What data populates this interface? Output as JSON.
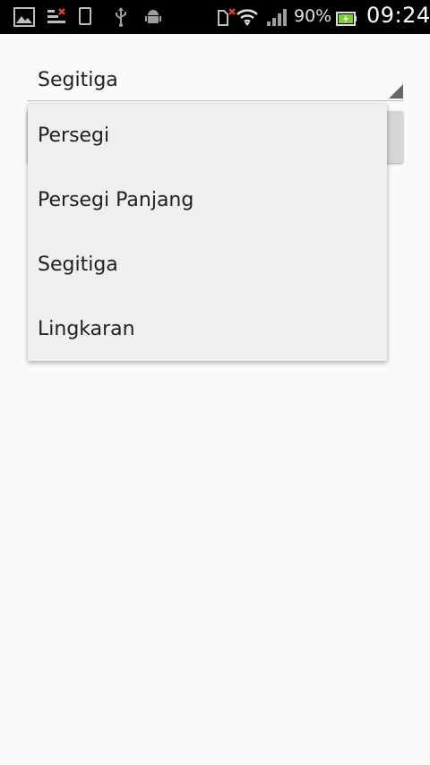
{
  "status_bar": {
    "icons": [
      "gallery-icon",
      "sms-error-icon",
      "device-icon",
      "usb-icon",
      "android-debug-icon",
      "no-sim-icon",
      "wifi-icon",
      "signal-icon",
      "battery-charging-icon"
    ],
    "battery_percent": "90%",
    "time": "09:24"
  },
  "spinner": {
    "selected": "Segitiga"
  },
  "dropdown": {
    "options": [
      "Persegi",
      "Persegi Panjang",
      "Segitiga",
      "Lingkaran"
    ]
  },
  "colors": {
    "background": "#fafafa",
    "dropdown_bg": "#efefef",
    "status_bar_bg": "#000000",
    "battery_green": "#7ccf2e"
  }
}
